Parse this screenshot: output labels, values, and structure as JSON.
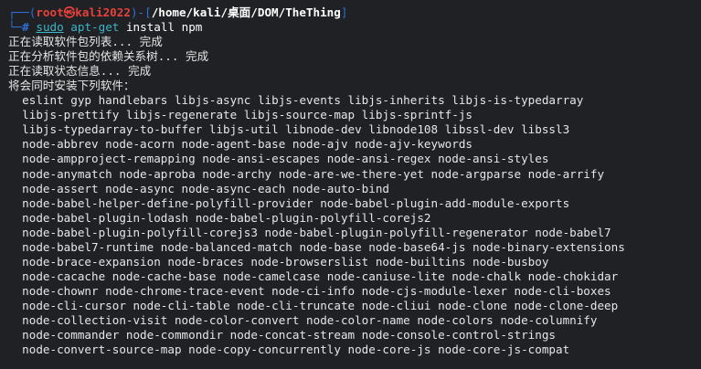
{
  "prompt": {
    "frame_open": "┌──(",
    "user_host": "root㉿kali2022",
    "frame_mid": ")-[",
    "path": "/home/kali/桌面/DOM/TheThing",
    "frame_close": "]",
    "line2_prefix": "└─",
    "hash": "#",
    "sudo": "sudo",
    "command": "apt-get",
    "args": "install npm"
  },
  "status_lines": [
    "正在读取软件包列表... 完成",
    "正在分析软件包的依赖关系树... 完成",
    "正在读取状态信息... 完成",
    "将会同时安装下列软件："
  ],
  "package_lines": [
    "  eslint gyp handlebars libjs-async libjs-events libjs-inherits libjs-is-typedarray",
    "  libjs-prettify libjs-regenerate libjs-source-map libjs-sprintf-js",
    "  libjs-typedarray-to-buffer libjs-util libnode-dev libnode108 libssl-dev libssl3",
    "  node-abbrev node-acorn node-agent-base node-ajv node-ajv-keywords",
    "  node-ampproject-remapping node-ansi-escapes node-ansi-regex node-ansi-styles",
    "  node-anymatch node-aproba node-archy node-are-we-there-yet node-argparse node-arrify",
    "  node-assert node-async node-async-each node-auto-bind",
    "  node-babel-helper-define-polyfill-provider node-babel-plugin-add-module-exports",
    "  node-babel-plugin-lodash node-babel-plugin-polyfill-corejs2",
    "  node-babel-plugin-polyfill-corejs3 node-babel-plugin-polyfill-regenerator node-babel7",
    "  node-babel7-runtime node-balanced-match node-base node-base64-js node-binary-extensions",
    "  node-brace-expansion node-braces node-browserslist node-builtins node-busboy",
    "  node-cacache node-cache-base node-camelcase node-caniuse-lite node-chalk node-chokidar",
    "  node-chownr node-chrome-trace-event node-ci-info node-cjs-module-lexer node-cli-boxes",
    "  node-cli-cursor node-cli-table node-cli-truncate node-cliui node-clone node-clone-deep",
    "  node-collection-visit node-color-convert node-color-name node-colors node-columnify",
    "  node-commander node-commondir node-concat-stream node-console-control-strings",
    "  node-convert-source-map node-copy-concurrently node-core-js node-core-js-compat"
  ],
  "colors": {
    "background": "#1f2124",
    "prompt_frame": "#2f6fd8",
    "prompt_user": "#e8413b",
    "command": "#3db6c8",
    "text": "#e6e6e6"
  }
}
